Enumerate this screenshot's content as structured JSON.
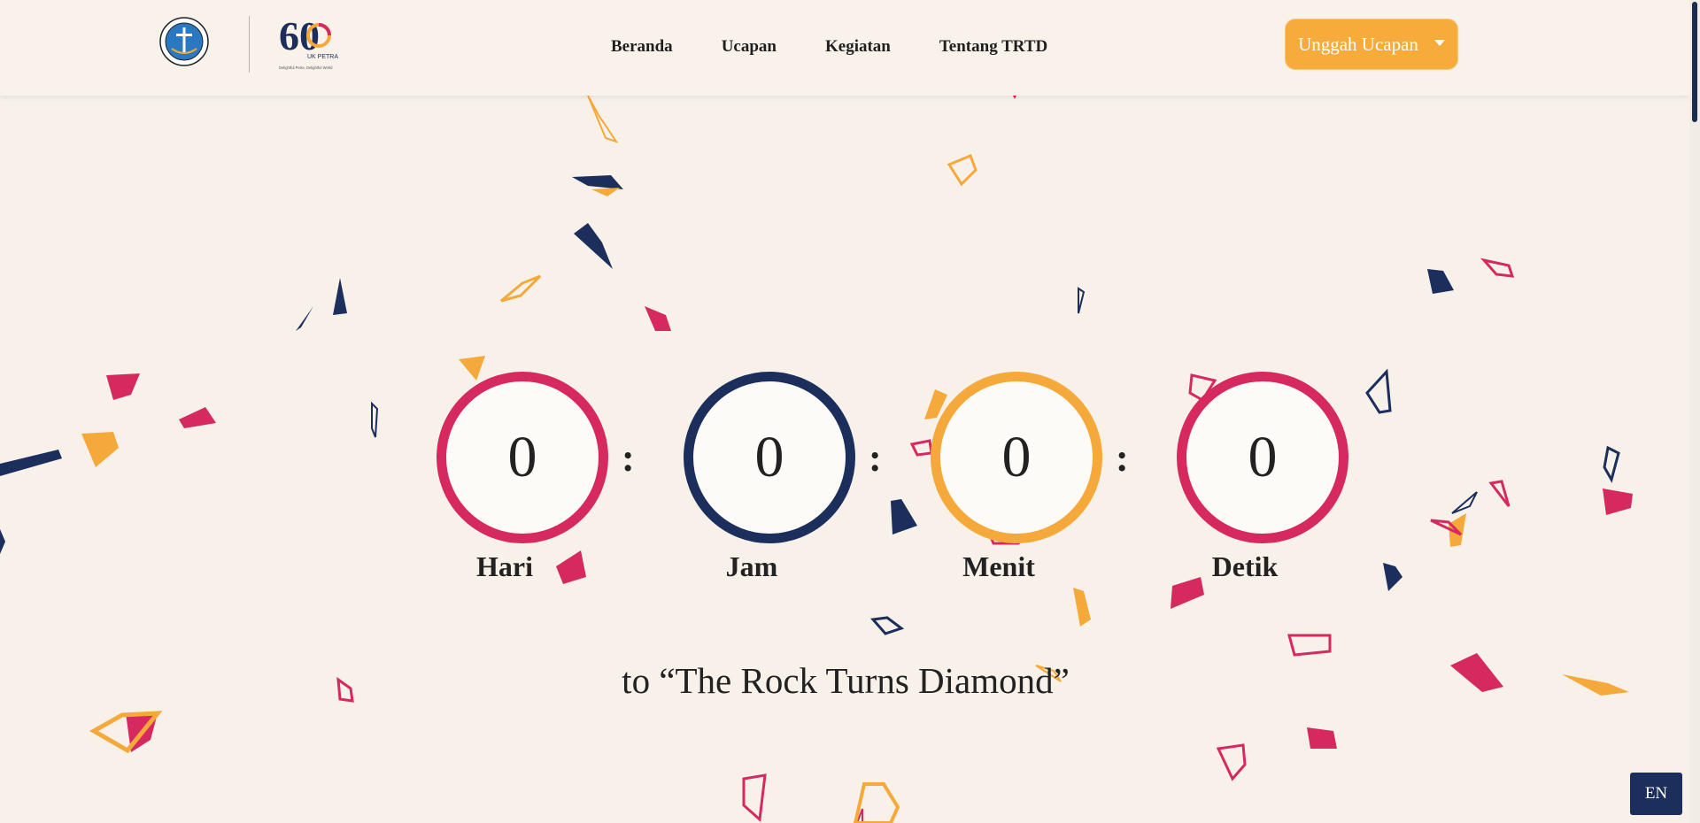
{
  "header": {
    "logo_university_alt": "UNIVERSITAS KRISTEN PETRA",
    "logo_60_number": "60",
    "logo_60_sub": "UK PETRA",
    "logo_60_tagline": "Delightful Petra, Delightful World"
  },
  "nav": {
    "items": [
      {
        "label": "Beranda"
      },
      {
        "label": "Ucapan"
      },
      {
        "label": "Kegiatan"
      },
      {
        "label": "Tentang TRTD"
      }
    ],
    "upload_label": "Unggah Ucapan"
  },
  "countdown": {
    "days": {
      "value": "0",
      "label": "Hari"
    },
    "hours": {
      "value": "0",
      "label": "Jam"
    },
    "minutes": {
      "value": "0",
      "label": "Menit"
    },
    "seconds": {
      "value": "0",
      "label": "Detik"
    },
    "separator": ":"
  },
  "tagline": "to “The Rock Turns Diamond”",
  "language_button": "EN",
  "colors": {
    "background": "#f7f1ea",
    "pink": "#d5295f",
    "navy": "#1c2e5c",
    "orange": "#f6a93b"
  }
}
